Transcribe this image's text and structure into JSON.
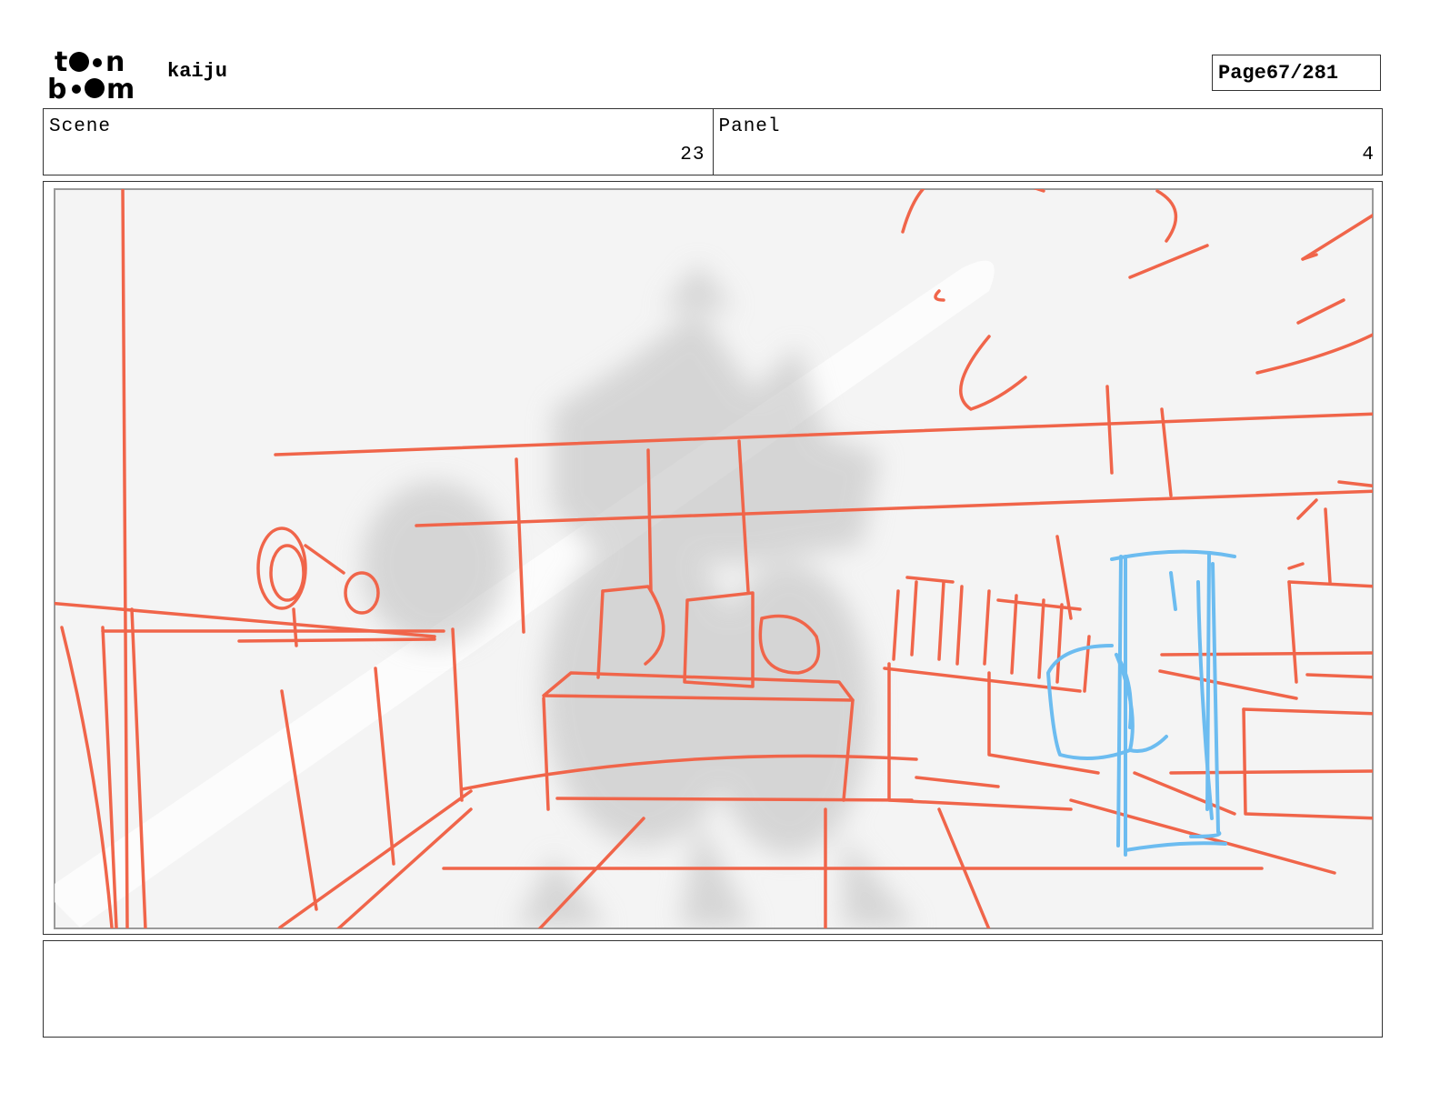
{
  "header": {
    "logo_text": "toonboom",
    "project_title": "kaiju",
    "page_label": "Page",
    "page_number": "67/281"
  },
  "info": {
    "scene_label": "Scene",
    "scene_value": "23",
    "panel_label": "Panel",
    "panel_value": "4"
  },
  "colors": {
    "sketch_red": "#f0654a",
    "sketch_blue": "#6cbcf0",
    "panel_bg": "#f4f4f4"
  },
  "notes": {
    "text": ""
  }
}
